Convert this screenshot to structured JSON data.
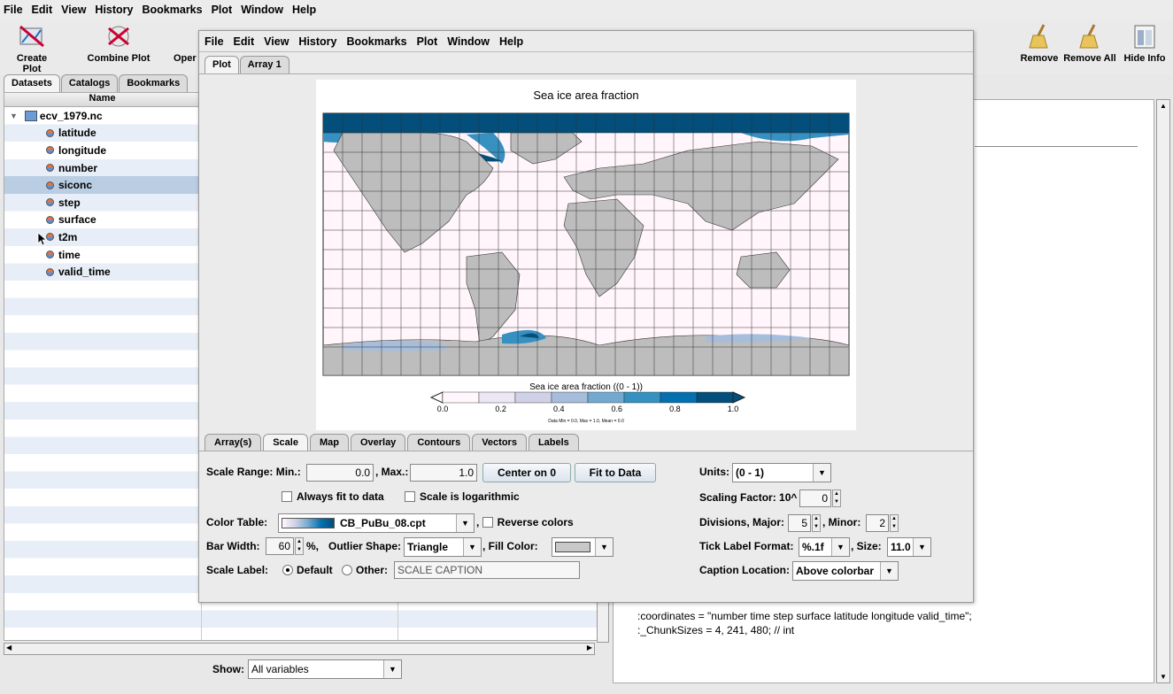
{
  "menubar": [
    "File",
    "Edit",
    "View",
    "History",
    "Bookmarks",
    "Plot",
    "Window",
    "Help"
  ],
  "toolbar": {
    "create_plot": "Create Plot",
    "combine_plot": "Combine Plot",
    "open": "Oper",
    "remove": "Remove",
    "remove_all": "Remove All",
    "hide_info": "Hide Info"
  },
  "left_tabs": [
    "Datasets",
    "Catalogs",
    "Bookmarks"
  ],
  "tree": {
    "column": "Name",
    "root": "ecv_1979.nc",
    "items": [
      "latitude",
      "longitude",
      "number",
      "siconc",
      "step",
      "surface",
      "t2m",
      "time",
      "valid_time"
    ],
    "selected": "siconc"
  },
  "show": {
    "label": "Show:",
    "value": "All variables"
  },
  "info": {
    "line1": ":coordinates = \"number time step surface latitude longitude valid_time\";",
    "line2": ":_ChunkSizes = 4, 241, 480; // int"
  },
  "plot_window": {
    "menubar": [
      "File",
      "Edit",
      "View",
      "History",
      "Bookmarks",
      "Plot",
      "Window",
      "Help"
    ],
    "tabs": [
      "Plot",
      "Array 1"
    ],
    "title": "Sea ice area fraction",
    "colorbar_title": "Sea ice area fraction ((0 - 1))",
    "colorbar_ticks": [
      "0.0",
      "0.2",
      "0.4",
      "0.6",
      "0.8",
      "1.0"
    ],
    "colorbar_note": "Data Min = 0.0, Max = 1.0, Mean = 0.0",
    "colors": {
      "land": "#bdbdbd",
      "ocean": "#fff5fb",
      "ice_dark": "#034e7b",
      "ice_mid": "#3690c0",
      "ice_light": "#a6bddb"
    },
    "bottom_tabs": [
      "Array(s)",
      "Scale",
      "Map",
      "Overlay",
      "Contours",
      "Vectors",
      "Labels"
    ],
    "scale": {
      "range_label": "Scale Range: Min.:",
      "min": "0.0",
      "max_label": ", Max.:",
      "max": "1.0",
      "center_btn": "Center on 0",
      "fit_btn": "Fit to Data",
      "always_fit": "Always fit to data",
      "logarithmic": "Scale is logarithmic",
      "color_table_label": "Color Table:",
      "color_table": "CB_PuBu_08.cpt",
      "reverse": "Reverse colors",
      "bar_width_label": "Bar Width:",
      "bar_width": "60",
      "pct": "%,",
      "outlier_label": "Outlier Shape:",
      "outlier": "Triangle",
      "fill_label": ", Fill Color:",
      "scale_label": "Scale Label:",
      "default": "Default",
      "other": "Other:",
      "caption": "SCALE CAPTION",
      "units_label": "Units:",
      "units": "(0 - 1)",
      "scaling_label": "Scaling Factor: 10^",
      "scaling": "0",
      "divisions_label": "Divisions, Major:",
      "major": "5",
      "minor_label": ", Minor:",
      "minor": "2",
      "tick_format_label": "Tick Label Format:",
      "tick_format": "%.1f",
      "size_label": ", Size:",
      "size": "11.0",
      "caption_loc_label": "Caption Location:",
      "caption_loc": "Above colorbar"
    }
  }
}
